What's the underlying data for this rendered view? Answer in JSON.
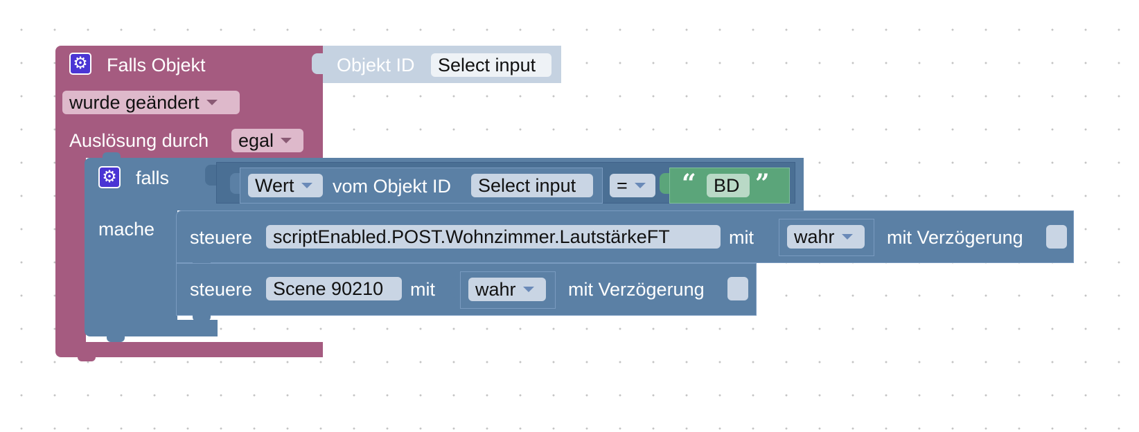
{
  "event_block": {
    "title": "Falls Objekt",
    "object_id_label": "Objekt ID",
    "object_id_value": "Select input",
    "trigger_value": "wurde geändert",
    "ack_label": "Auslösung durch",
    "ack_value": "egal",
    "color": "#a55b80"
  },
  "if_block": {
    "if_label": "falls",
    "do_label": "mache",
    "color": "#5b80a5"
  },
  "condition": {
    "attribute_value": "Wert",
    "object_label": "vom Objekt ID",
    "object_value": "Select input",
    "operator": "=",
    "text_value": "BD",
    "text_color": "#5ba57a"
  },
  "control_1": {
    "label": "steuere",
    "object_value": "scriptEnabled.POST.Wohnzimmer.LautstärkeFT",
    "with_label": "mit",
    "value": "wahr",
    "delay_label": "mit Verzögerung"
  },
  "control_2": {
    "label": "steuere",
    "object_value": "Scene 90210",
    "with_label": "mit",
    "value": "wahr",
    "delay_label": "mit Verzögerung"
  }
}
